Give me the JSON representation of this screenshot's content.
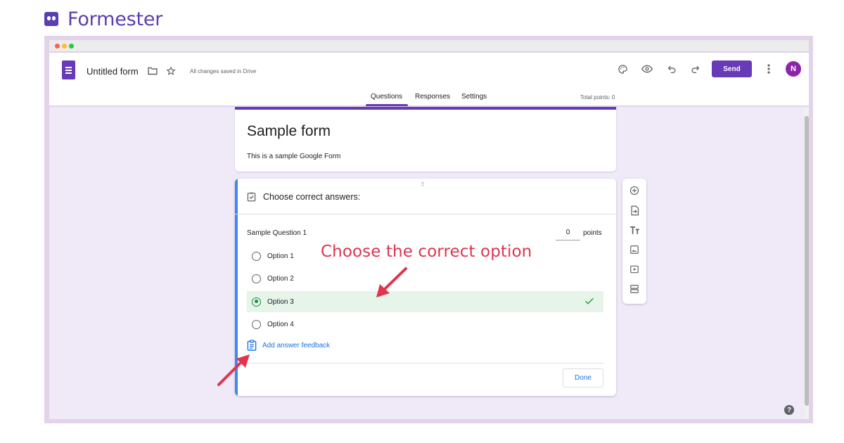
{
  "brand": {
    "name": "Formester"
  },
  "window": {
    "dots": [
      "#ff5f57",
      "#ffbd2e",
      "#28c840"
    ]
  },
  "toolbar": {
    "doc_title": "Untitled form",
    "saved_status": "All changes saved in Drive",
    "send_label": "Send",
    "avatar_initial": "N",
    "icons": [
      "palette-icon",
      "eye-icon",
      "undo-icon",
      "redo-icon",
      "more-vert-icon"
    ]
  },
  "tabs": [
    {
      "label": "Questions",
      "active": true
    },
    {
      "label": "Responses",
      "active": false
    },
    {
      "label": "Settings",
      "active": false
    }
  ],
  "total_points": "Total points: 0",
  "form": {
    "title": "Sample form",
    "description": "This is a sample Google Form"
  },
  "answer_key": {
    "header": "Choose correct answers:",
    "question": "Sample Question 1",
    "points_value": "0",
    "points_label": "points",
    "options": [
      {
        "label": "Option 1",
        "correct": false
      },
      {
        "label": "Option 2",
        "correct": false
      },
      {
        "label": "Option 3",
        "correct": true
      },
      {
        "label": "Option 4",
        "correct": false
      }
    ],
    "feedback_label": "Add answer feedback",
    "done_label": "Done"
  },
  "side_tools": [
    "add-question-icon",
    "import-questions-icon",
    "add-title-icon",
    "add-image-icon",
    "add-video-icon",
    "add-section-icon"
  ],
  "annotation": {
    "text": "Choose the correct option",
    "color": "#e0344f"
  },
  "colors": {
    "brand": "#5b3fb0",
    "forms_purple": "#673ab7",
    "accent_blue": "#4285f4",
    "correct_green": "#1e8e3e"
  },
  "help": {
    "label": "?"
  }
}
